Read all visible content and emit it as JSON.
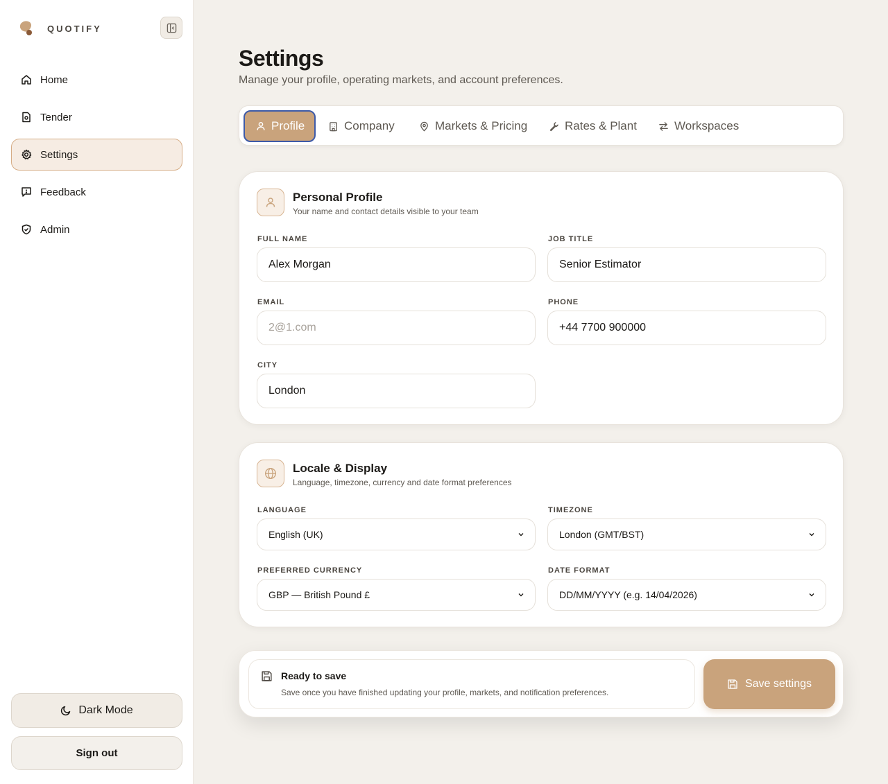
{
  "app": {
    "name": "QUOTIFY"
  },
  "sidebar": {
    "items": [
      {
        "label": "Home",
        "icon": "home-icon",
        "active": false
      },
      {
        "label": "Tender",
        "icon": "document-icon",
        "active": false
      },
      {
        "label": "Settings",
        "icon": "gear-icon",
        "active": true
      },
      {
        "label": "Feedback",
        "icon": "message-icon",
        "active": false
      },
      {
        "label": "Admin",
        "icon": "shield-icon",
        "active": false
      }
    ],
    "dark_mode_label": "Dark Mode",
    "sign_out_label": "Sign out"
  },
  "page": {
    "title": "Settings",
    "subtitle": "Manage your profile, operating markets, and account preferences."
  },
  "tabs": [
    {
      "label": "Profile",
      "icon": "user-icon",
      "active": true
    },
    {
      "label": "Company",
      "icon": "building-icon",
      "active": false
    },
    {
      "label": "Markets & Pricing",
      "icon": "map-pin-icon",
      "active": false
    },
    {
      "label": "Rates & Plant",
      "icon": "wrench-icon",
      "active": false
    },
    {
      "label": "Workspaces",
      "icon": "swap-icon",
      "active": false
    }
  ],
  "profile": {
    "title": "Personal Profile",
    "subtitle": "Your name and contact details visible to your team",
    "full_name": {
      "label": "FULL NAME",
      "value": "Alex Morgan"
    },
    "job_title": {
      "label": "JOB TITLE",
      "value": "Senior Estimator"
    },
    "email": {
      "label": "EMAIL",
      "placeholder": "2@1.com"
    },
    "phone": {
      "label": "PHONE",
      "value": "+44 7700 900000"
    },
    "city": {
      "label": "CITY",
      "value": "London"
    }
  },
  "locale": {
    "title": "Locale & Display",
    "subtitle": "Language, timezone, currency and date format preferences",
    "language": {
      "label": "LANGUAGE",
      "value": "English (UK)"
    },
    "timezone": {
      "label": "TIMEZONE",
      "value": "London (GMT/BST)"
    },
    "currency": {
      "label": "PREFERRED CURRENCY",
      "value": "GBP — British Pound £"
    },
    "date_format": {
      "label": "DATE FORMAT",
      "value": "DD/MM/YYYY (e.g. 14/04/2026)"
    }
  },
  "save": {
    "title": "Ready to save",
    "subtitle": "Save once you have finished updating your profile, markets, and notification preferences.",
    "button_label": "Save settings"
  },
  "colors": {
    "accent": "#c9a37c",
    "active_nav_bg": "#f6ece3",
    "background": "#f3f0eb",
    "focus_ring": "#3d5aa8"
  }
}
